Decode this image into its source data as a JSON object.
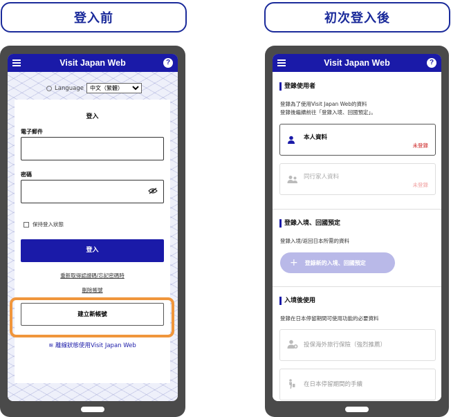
{
  "labels": {
    "before": "登入前",
    "after": "初次登入後"
  },
  "app": {
    "title": "Visit Japan Web",
    "help": "?"
  },
  "login": {
    "language_label": "Language",
    "language_value": "中文（繁體）",
    "heading": "登入",
    "email_label": "電子郵件",
    "password_label": "密碼",
    "keep_signed_in": "保持登入狀態",
    "login_button": "登入",
    "reset_link": "重新取得認證碼/忘記密碼時",
    "delete_link": "刪除帳號",
    "create_account": "建立新帳號",
    "offline_link": "離線狀態使用Visit Japan Web"
  },
  "after": {
    "users": {
      "heading": "登錄使用者",
      "desc1": "登錄為了使用Visit Japan Web的資料",
      "desc2": "登錄後繼續前往「登錄入境、回國預定」。",
      "personal": {
        "name": "本人資料",
        "status": "未登錄"
      },
      "family": {
        "name": "同行家人資料",
        "status": "未登錄"
      }
    },
    "entry": {
      "heading": "登錄入境、回國預定",
      "desc": "登錄入境/返回日本所需的資料",
      "button": "登錄新的入境、回國預定"
    },
    "post_entry": {
      "heading": "入境後使用",
      "desc": "登錄在日本停留期間可使用功能的必要資料",
      "item1": "投保海外旅行保險（強烈推薦）",
      "item2": "在日本停留期間的手續"
    }
  }
}
